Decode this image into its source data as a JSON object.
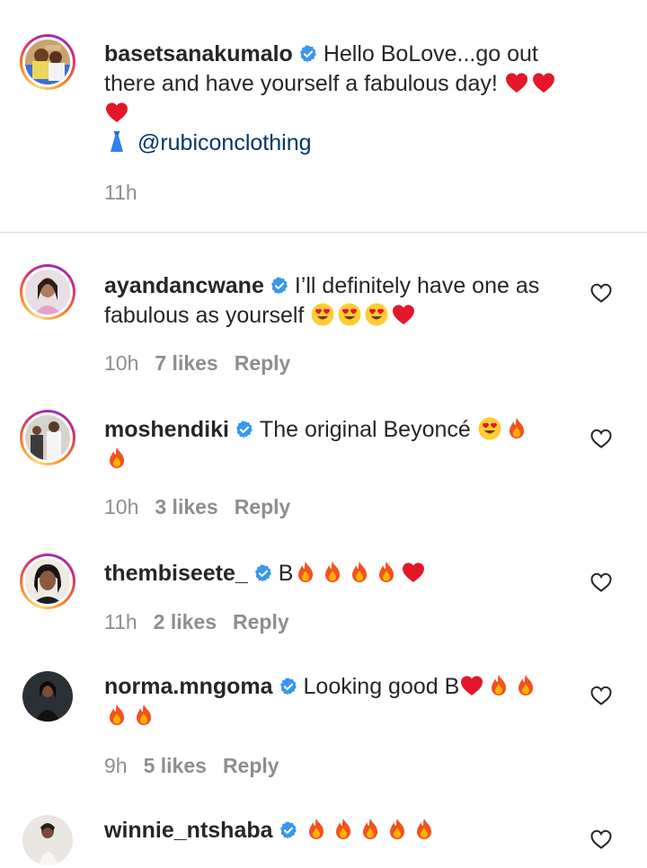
{
  "caption": {
    "username": "basetsanakumalo",
    "text": "Hello BoLove...go out there and have yourself a fabulous day!",
    "mention": "@rubiconclothing",
    "time": "11h"
  },
  "comments": [
    {
      "username": "ayandancwane",
      "text": "I’ll definitely have one as fabulous as yourself",
      "time": "10h",
      "likes": "7 likes",
      "reply": "Reply"
    },
    {
      "username": "moshendiki",
      "text": "The original Beyoncé",
      "time": "10h",
      "likes": "3 likes",
      "reply": "Reply"
    },
    {
      "username": "thembiseete_",
      "text": "B",
      "time": "11h",
      "likes": "2 likes",
      "reply": "Reply"
    },
    {
      "username": "norma.mngoma",
      "text": "Looking good B",
      "time": "9h",
      "likes": "5 likes",
      "reply": "Reply"
    },
    {
      "username": "winnie_ntshaba",
      "text": ""
    }
  ],
  "colors": {
    "verified": "#3897f0",
    "mention": "#00376b",
    "meta": "#8e8e8e"
  },
  "icons": {
    "verified": "verified-badge-icon",
    "like": "heart-outline-icon",
    "emojis": [
      "red-heart",
      "heart-eyes",
      "fire",
      "dress"
    ]
  }
}
